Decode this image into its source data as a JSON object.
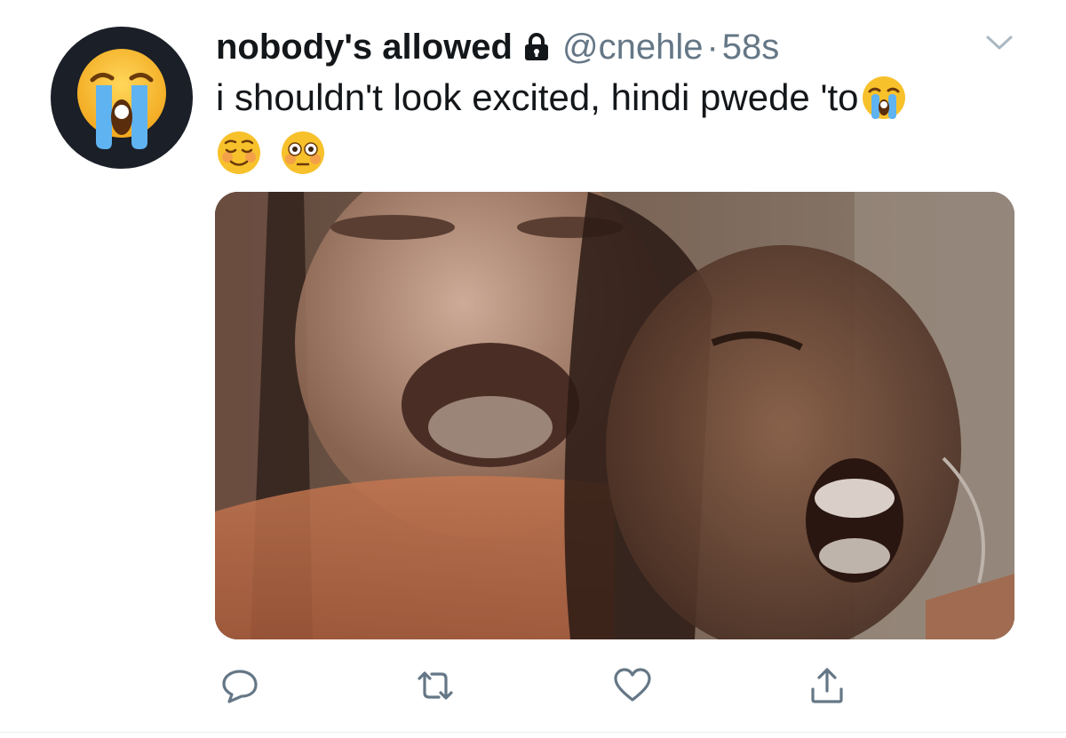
{
  "tweet": {
    "display_name": "nobody's allowed",
    "handle": "@cnehle",
    "separator": "·",
    "time": "58s",
    "text": "i shouldn't look excited, hindi pwede 'to",
    "protected": true,
    "emojis_inline": [
      "loudly-crying-face"
    ],
    "emojis_row": [
      "relieved-smiling-face",
      "flushed-face"
    ],
    "avatar_emoji": "loudly-crying-face",
    "media_description_icon": "photo"
  },
  "actions": [
    {
      "name": "reply",
      "icon": "reply-icon"
    },
    {
      "name": "retweet",
      "icon": "retweet-icon"
    },
    {
      "name": "like",
      "icon": "heart-icon"
    },
    {
      "name": "share",
      "icon": "share-icon"
    }
  ],
  "colors": {
    "text": "#14171a",
    "secondary": "#657786",
    "icon": "#657786",
    "avatar_bg": "#1a1f28"
  }
}
